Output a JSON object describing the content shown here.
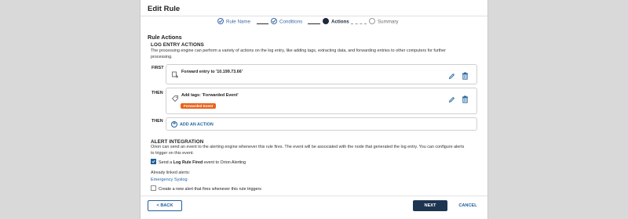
{
  "dialog": {
    "title": "Edit Rule"
  },
  "wizard": {
    "steps": [
      {
        "label": "Rule Name",
        "state": "done"
      },
      {
        "label": "Conditions",
        "state": "done"
      },
      {
        "label": "Actions",
        "state": "active"
      },
      {
        "label": "Summary",
        "state": "future"
      }
    ]
  },
  "section_title": "Rule Actions",
  "log_entry": {
    "heading": "LOG ENTRY ACTIONS",
    "description": "The processing engine can perform a variety of actions on the log entry, like adding tags, extracting data, and forwarding entries to other computers for further processing.",
    "rows": [
      {
        "label": "FIRST",
        "text": "Forward entry to '10.199.73.66'",
        "icon": "forward-icon"
      },
      {
        "label": "THEN",
        "text": "Add tags: 'Forwarded Event'",
        "icon": "tag-icon",
        "tag": "Forwarded Event"
      },
      {
        "label": "THEN",
        "text": "ADD AN ACTION",
        "icon": "plus-circle-icon"
      }
    ]
  },
  "alert": {
    "heading": "ALERT INTEGRATION",
    "description": "Orion can send an event to the alerting engine whenever this rule fires. The event will be associated with the node that generated the log entry. You can configure alerts to trigger on this event.",
    "send_event": {
      "checked": true,
      "prefix": "Send a ",
      "bold": "Log Rule Fired",
      "suffix": " event to Orion Alerting"
    },
    "linked_label": "Already linked alerts:",
    "linked_alert": "Emergency Syslog",
    "create_new": {
      "checked": false,
      "label": "Create a new alert that fires whenever this rule triggers"
    }
  },
  "footer": {
    "back": "< BACK",
    "next": "NEXT",
    "cancel": "CANCEL"
  },
  "colors": {
    "accent": "#1e5f9e",
    "primary_dark": "#1d3550",
    "tag_orange": "#e8641b"
  }
}
